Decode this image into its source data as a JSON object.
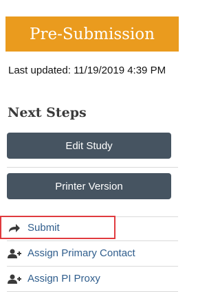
{
  "status": {
    "label": "Pre-Submission",
    "color": "#ea9b1e"
  },
  "last_updated": "Last updated: 11/19/2019 4:39 PM",
  "next_steps": {
    "title": "Next Steps",
    "buttons": [
      {
        "label": "Edit Study"
      },
      {
        "label": "Printer Version"
      }
    ],
    "actions": [
      {
        "label": "Submit",
        "icon": "share-arrow-icon",
        "highlighted": true
      },
      {
        "label": "Assign Primary Contact",
        "icon": "add-user-icon"
      },
      {
        "label": "Assign PI Proxy",
        "icon": "add-user-icon"
      }
    ]
  },
  "colors": {
    "button_bg": "#465461",
    "link": "#2f5d8c",
    "highlight_border": "#e03a3e"
  }
}
